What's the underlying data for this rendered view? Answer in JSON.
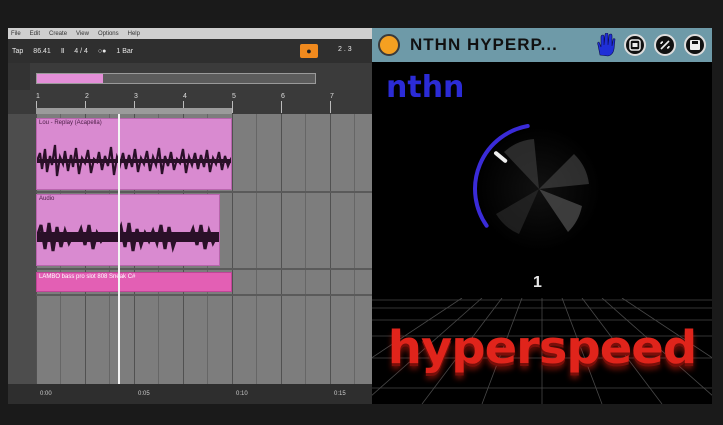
{
  "daw": {
    "menu": [
      "File",
      "Edit",
      "Create",
      "View",
      "Options",
      "Help"
    ],
    "transport": {
      "tap": "Tap",
      "tempo": "86.41",
      "metronome_glyph": "Ⅱ",
      "time_signature": "4 / 4",
      "loop_toggle": "○●",
      "quantize": "1 Bar",
      "position_right": "2 .  3"
    },
    "ruler_bars": [
      "1",
      "2",
      "3",
      "4",
      "5",
      "6",
      "7"
    ],
    "tracks": [
      {
        "clip_title": "Lou - Replay (Acapella)",
        "type": "audio"
      },
      {
        "clip_title": "Audio",
        "type": "audio"
      },
      {
        "clip_title": "LAMBO  bass  pro  slot  808  Sneak  C#",
        "type": "midi"
      }
    ],
    "time_markers": [
      "0:00",
      "0:05",
      "0:10",
      "0:15"
    ]
  },
  "plugin": {
    "title": "NTHN  HYPERP...",
    "brand": "nthn",
    "knob_value": "1",
    "knob_level": 0.12,
    "wordmark": "hyperspeed",
    "colors": {
      "header": "#6e9aa8",
      "power": "#f5a021",
      "brand": "#2b2bd6",
      "wordmark": "#e0241b",
      "knob_arc": "#3a2bd8"
    },
    "icons": [
      "power-icon",
      "hand-icon",
      "plugin-menu-icon",
      "link-icon",
      "save-icon"
    ]
  }
}
